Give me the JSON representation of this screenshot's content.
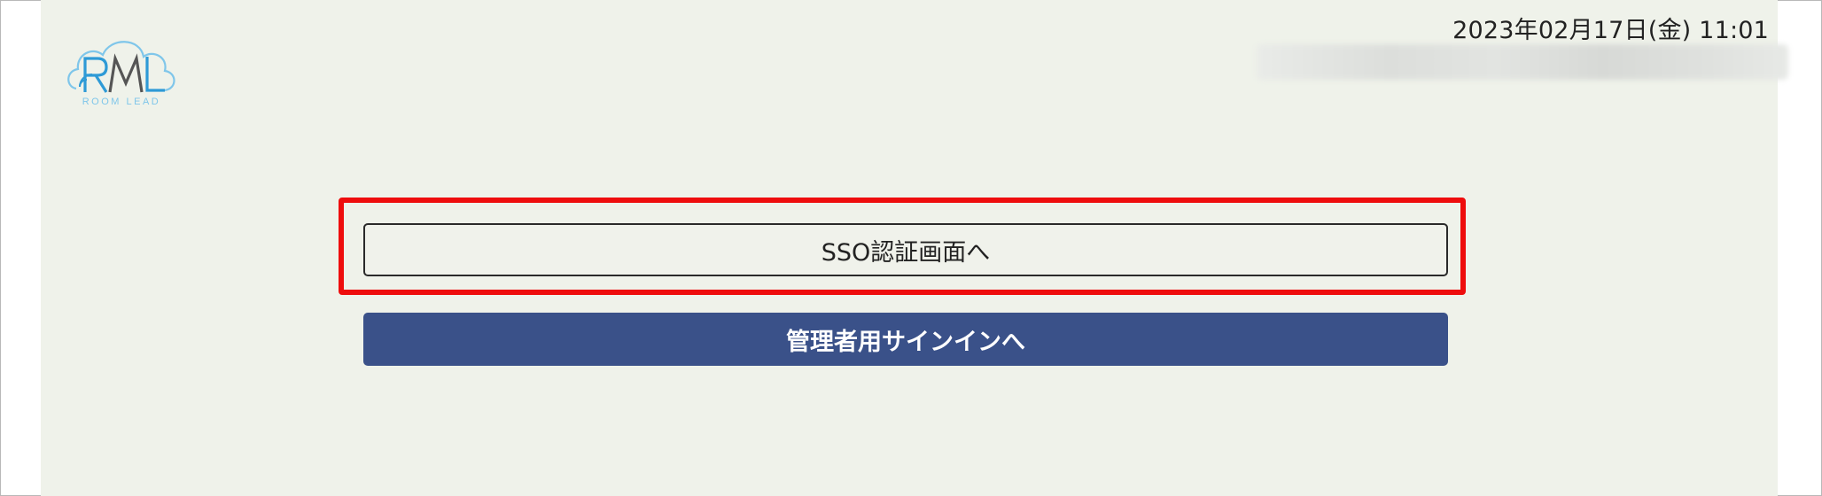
{
  "header": {
    "datetime": "2023年02月17日(金) 11:01",
    "logo": {
      "mark_text": "RML",
      "subtitle": "ROOM LEAD",
      "colors": {
        "primary": "#2e9ad6",
        "secondary": "#4a4a4a",
        "cloud": "#7fc6ea"
      }
    }
  },
  "main": {
    "sso_button_label": "SSO認証画面へ",
    "admin_button_label": "管理者用サインインへ"
  },
  "colors": {
    "panel_bg": "#eff2ea",
    "admin_button_bg": "#3a5189",
    "highlight_border": "#ee0d0d"
  }
}
